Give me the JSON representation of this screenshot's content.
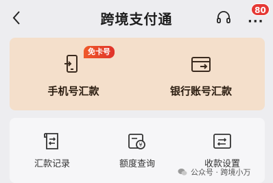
{
  "header": {
    "title": "跨境支付通",
    "badge_count": "80",
    "back_icon": "chevron-left-icon",
    "support_icon": "headset-icon",
    "more_icon": "more-dots-icon"
  },
  "remit": {
    "items": [
      {
        "label": "手机号汇款",
        "tag": "免卡号",
        "icon": "phone-transfer-icon"
      },
      {
        "label": "银行账号汇款",
        "icon": "bank-card-icon"
      }
    ]
  },
  "services": {
    "items": [
      {
        "label": "汇款记录",
        "icon": "record-icon"
      },
      {
        "label": "额度查询",
        "icon": "quota-icon"
      },
      {
        "label": "收款设置",
        "icon": "settings-card-icon"
      }
    ]
  },
  "watermark": {
    "text": "公众号 · 跨境小万"
  },
  "colors": {
    "remit_card_bg": "#f4dfcb",
    "tag_bg": "#e0322a",
    "badge_bg": "#e53935"
  }
}
